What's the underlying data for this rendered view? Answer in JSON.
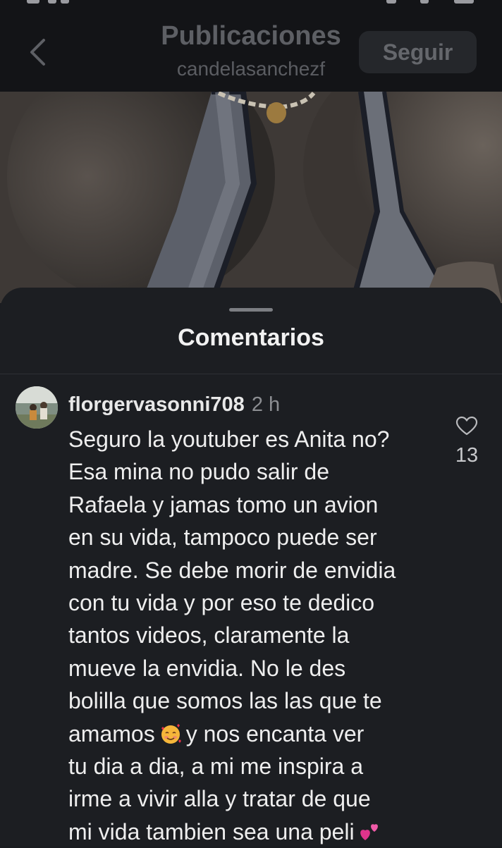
{
  "header": {
    "title": "Publicaciones",
    "username": "candelasanchezf",
    "follow_label": "Seguir",
    "back_icon": "chevron-left-icon"
  },
  "photo": {
    "description_icon": "post-photo"
  },
  "comments_sheet": {
    "title": "Comentarios",
    "comments": [
      {
        "username": "florgervasonni708",
        "time": "2 h",
        "lines": [
          "Seguro la youtuber es Anita no?",
          "Esa mina no pudo salir de",
          "Rafaela y jamas tomo un avion",
          "en su vida, tampoco puede ser",
          "madre. Se debe morir de envidia",
          "con tu vida y por eso te dedico",
          "tantos videos, claramente la",
          "mueve la envidia. No le des",
          "bolilla que somos las las que te",
          "amamos",
          "y nos encanta ver",
          "tu dia a dia, a mi me inspira a",
          "irme a vivir alla y tratar de que",
          "mi vida tambien sea una peli"
        ],
        "like_count": "13",
        "like_icon": "heart-outline-icon",
        "emojis": [
          "smiling-face-with-hearts",
          "two-hearts"
        ]
      }
    ]
  },
  "colors": {
    "background": "#1c1e22",
    "header_bg": "#131417",
    "text": "#eeeeee",
    "muted": "#8c8e92"
  }
}
